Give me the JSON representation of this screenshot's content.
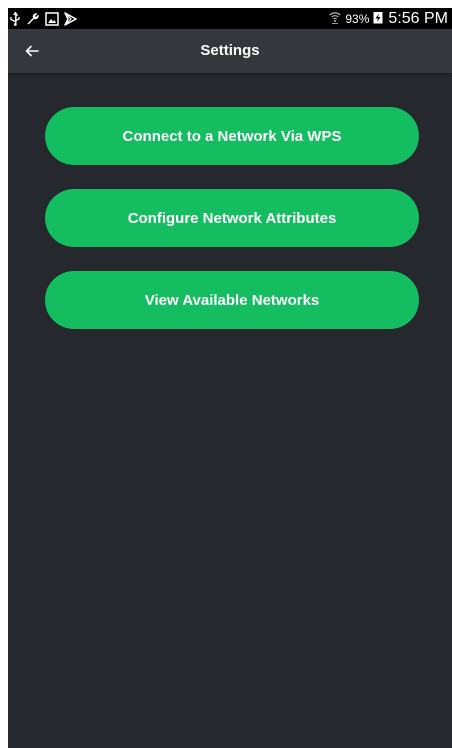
{
  "status_bar": {
    "left_icons": [
      "usb-icon",
      "wrench-icon",
      "image-icon",
      "play-store-icon"
    ],
    "battery_percent": "93%",
    "time": "5:56 PM"
  },
  "app_bar": {
    "title": "Settings"
  },
  "buttons": [
    {
      "label": "Connect to a Network Via WPS"
    },
    {
      "label": "Configure Network Attributes"
    },
    {
      "label": "View Available Networks"
    }
  ],
  "colors": {
    "background": "#25282d",
    "app_bar": "#34373c",
    "accent_green": "#14bd5f"
  }
}
